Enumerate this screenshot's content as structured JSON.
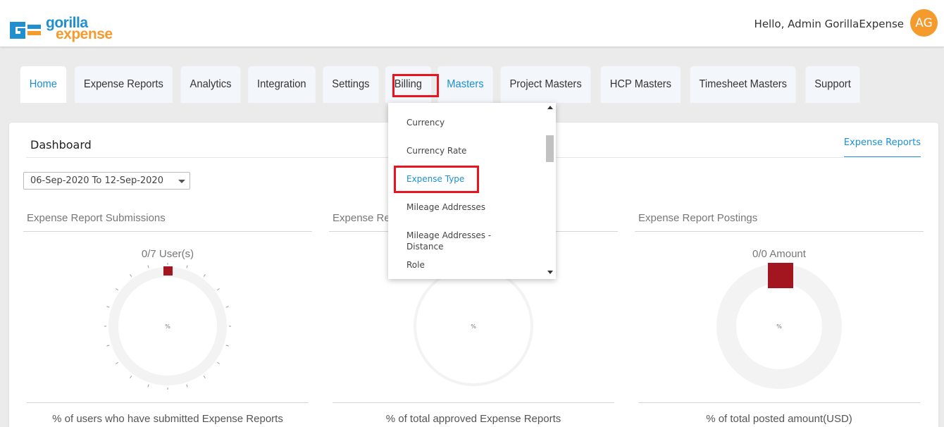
{
  "header": {
    "logo": {
      "word1": "gorilla",
      "word2": "expense",
      "mark_color": "#1f8fce",
      "accent_color": "#f59b2e"
    },
    "greeting": "Hello, Admin GorillaExpense",
    "avatar_initials": "AG"
  },
  "tabs": [
    {
      "label": "Home"
    },
    {
      "label": "Expense Reports"
    },
    {
      "label": "Analytics"
    },
    {
      "label": "Integration"
    },
    {
      "label": "Settings"
    },
    {
      "label": "Billing"
    },
    {
      "label": "Masters"
    },
    {
      "label": "Project Masters"
    },
    {
      "label": "HCP Masters"
    },
    {
      "label": "Timesheet Masters"
    },
    {
      "label": "Support"
    }
  ],
  "dashboard": {
    "title": "Dashboard",
    "link": "Expense Reports",
    "date_range": "06-Sep-2020 To 12-Sep-2020"
  },
  "panels": [
    {
      "title": "Expense Report Submissions",
      "value": "0/7 User(s)",
      "center": "%",
      "caption": "% of users who have submitted Expense Reports"
    },
    {
      "title": "Expense Re",
      "value": "",
      "center": "%",
      "caption": "% of total approved Expense Reports"
    },
    {
      "title": "Expense Report Postings",
      "value": "0/0 Amount",
      "center": "%",
      "caption": "% of total posted amount(USD)"
    }
  ],
  "masters_menu": {
    "items": [
      {
        "label": "Currency"
      },
      {
        "label": "Currency Rate"
      },
      {
        "label": "Expense Type"
      },
      {
        "label": "Mileage Addresses"
      },
      {
        "label": "Mileage Addresses - Distance"
      },
      {
        "label": "Role"
      }
    ]
  },
  "colors": {
    "accent": "#1b8fd5",
    "highlight": "#e8141e",
    "gauge_marker": "#a3151f"
  }
}
